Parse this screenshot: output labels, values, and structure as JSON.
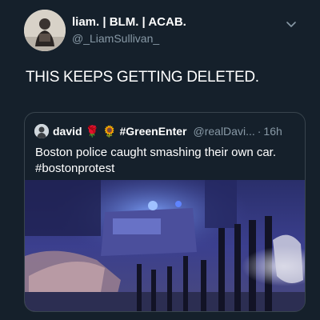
{
  "tweet": {
    "author_name": "liam. | BLM. | ACAB.",
    "author_handle": "@_LiamSullivan_",
    "text": "THIS KEEPS GETTING DELETED.",
    "menu_icon": "chevron-down-icon"
  },
  "quoted_tweet": {
    "author_name": "david",
    "emoji_1": "🌹",
    "emoji_2": "🌻",
    "hashtag_name": "#GreenEnter",
    "author_handle": "@realDavi...",
    "separator": "·",
    "timestamp": "16h",
    "text": "Boston police caught smashing their own car. #bostonprotest",
    "media_type": "video-thumbnail"
  },
  "colors": {
    "background": "#15202b",
    "primary_text": "#ffffff",
    "secondary_text": "#8899a6",
    "border": "#38444d"
  }
}
